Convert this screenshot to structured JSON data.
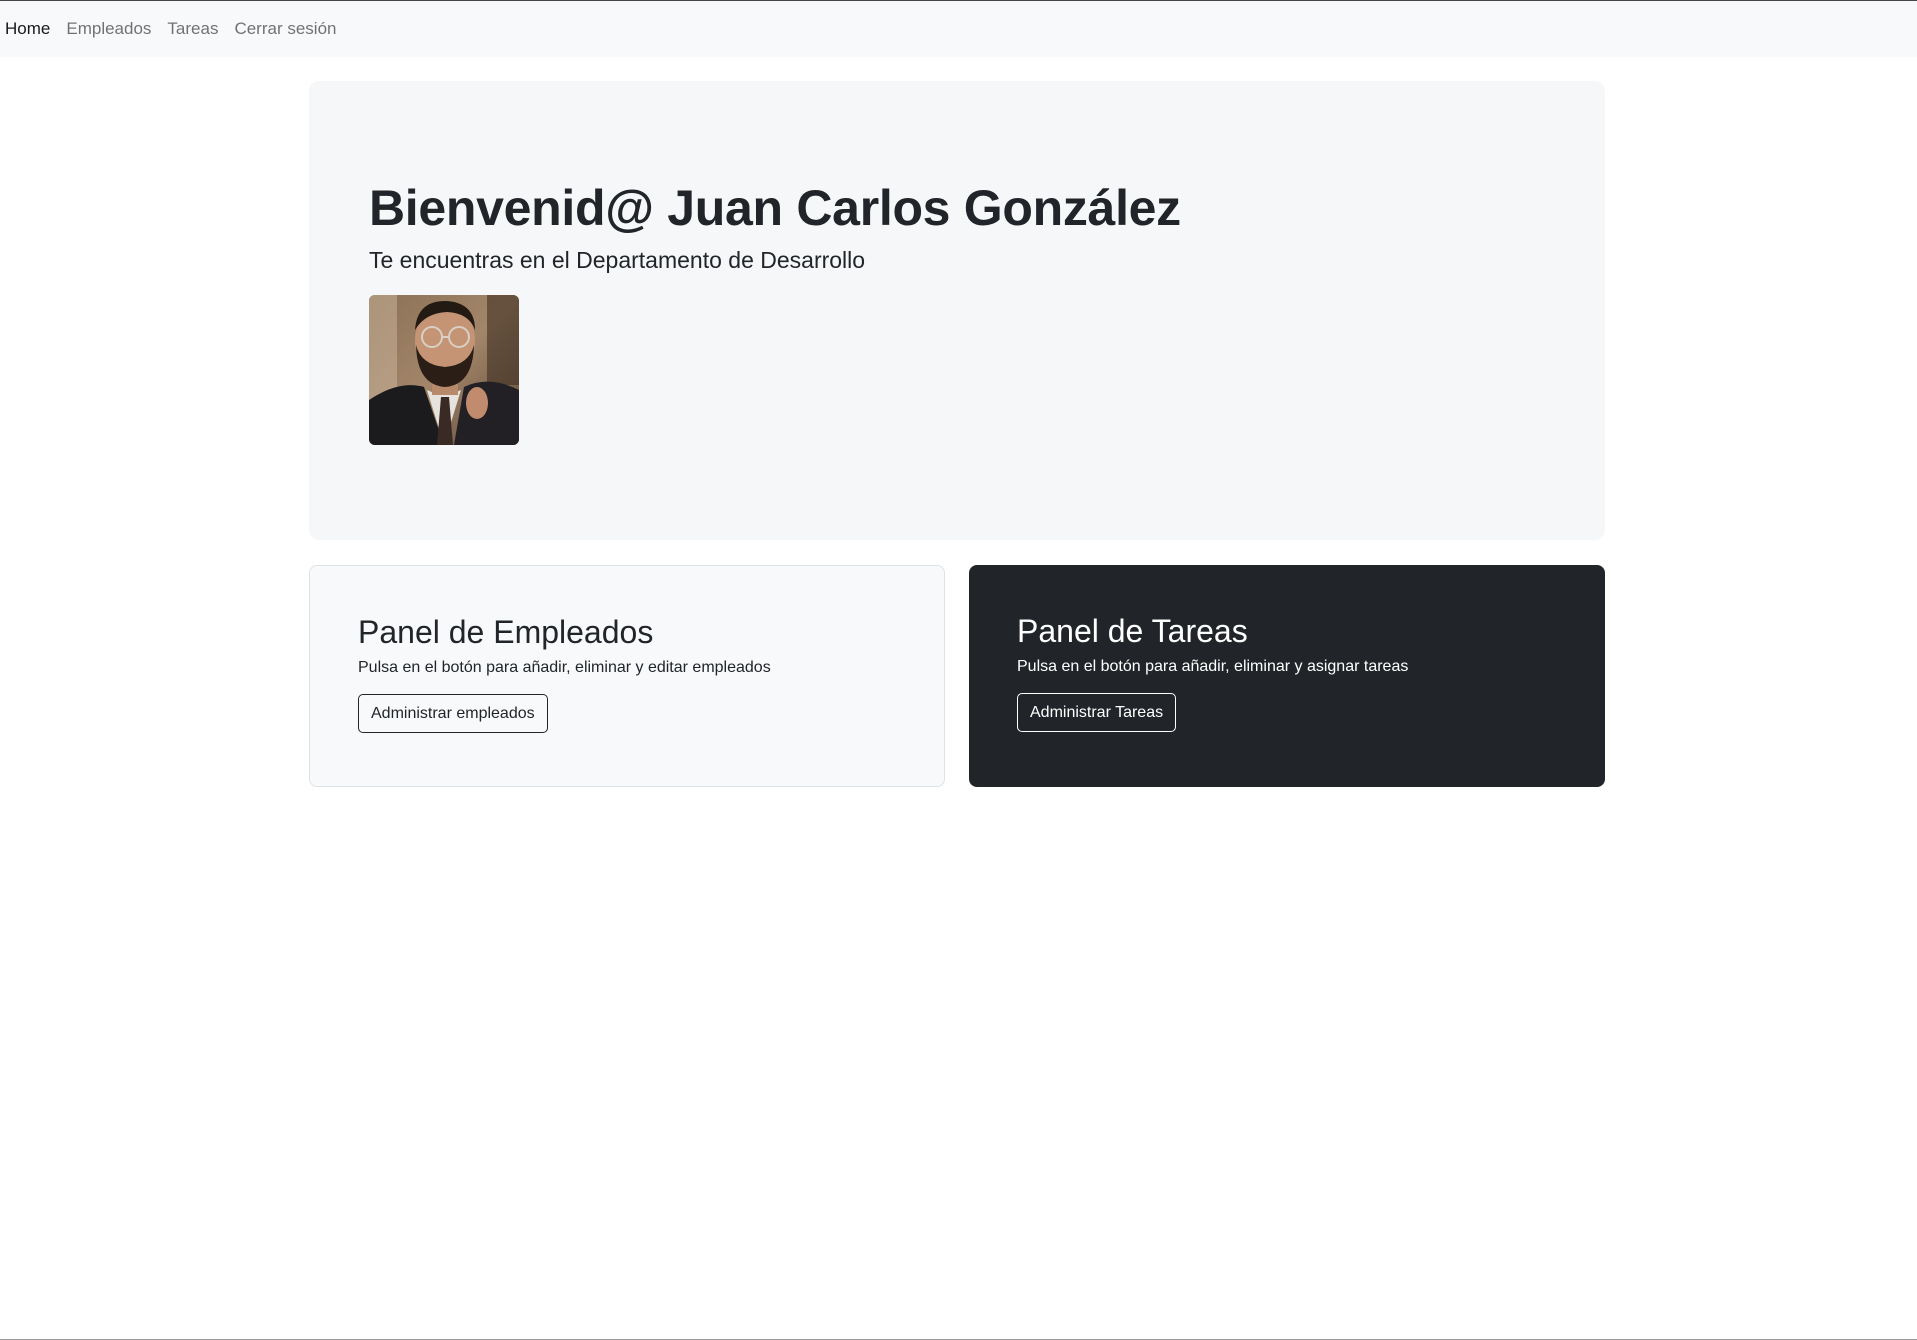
{
  "nav": {
    "items": [
      {
        "label": "Home",
        "active": true
      },
      {
        "label": "Empleados",
        "active": false
      },
      {
        "label": "Tareas",
        "active": false
      },
      {
        "label": "Cerrar sesión",
        "active": false
      }
    ]
  },
  "hero": {
    "title": "Bienvenid@ Juan Carlos González",
    "subtitle": "Te encuentras en el Departamento de Desarrollo"
  },
  "panels": {
    "employees": {
      "title": "Panel de Empleados",
      "text": "Pulsa en el botón para añadir, eliminar y editar empleados",
      "button": "Administrar empleados"
    },
    "tasks": {
      "title": "Panel de Tareas",
      "text": "Pulsa en el botón para añadir, eliminar y asignar tareas",
      "button": "Administrar Tareas"
    }
  },
  "colors": {
    "navbar_bg": "#f8f9fa",
    "jumbotron_bg": "#f6f7f9",
    "dark_panel_bg": "#212529"
  }
}
